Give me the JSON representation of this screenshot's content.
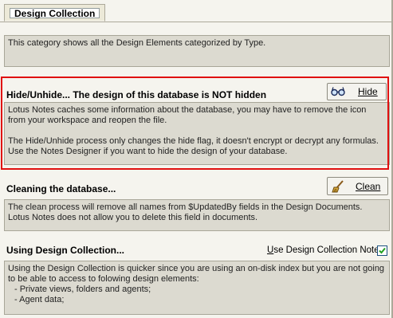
{
  "tab": {
    "label": "Design Collection"
  },
  "intro": {
    "text": "This category shows all the Design Elements categorized by Type."
  },
  "hide_section": {
    "title": "Hide/Unhide... The design of this database is NOT hidden",
    "button_label": "Hide",
    "para1": "Lotus Notes caches some information about the database, you may have to remove the icon from your workspace and reopen the file.",
    "para2": "The Hide/Unhide process only changes the hide flag, it doesn't encrypt or decrypt any formulas. Use the Notes Designer if you want to hide the design of your database."
  },
  "clean_section": {
    "title": "Cleaning the database...",
    "button_label": "Clean",
    "text": "The clean process will remove all names from $UpdatedBy fields in the Design Documents. Lotus Notes does not allow you to delete this field in documents."
  },
  "collection_section": {
    "title": "Using Design Collection...",
    "checkbox_label": "Use Design Collection Note",
    "checkbox_checked": true,
    "text": "Using the Design Collection is quicker since you are using an on-disk index but you are not going to be able to access to folowing design elements:",
    "items": [
      "- Private views, folders and agents;",
      "- Agent data;"
    ]
  },
  "colors": {
    "highlight": "#e01010",
    "panel_bg": "#dcdad0",
    "check": "#21a121"
  }
}
